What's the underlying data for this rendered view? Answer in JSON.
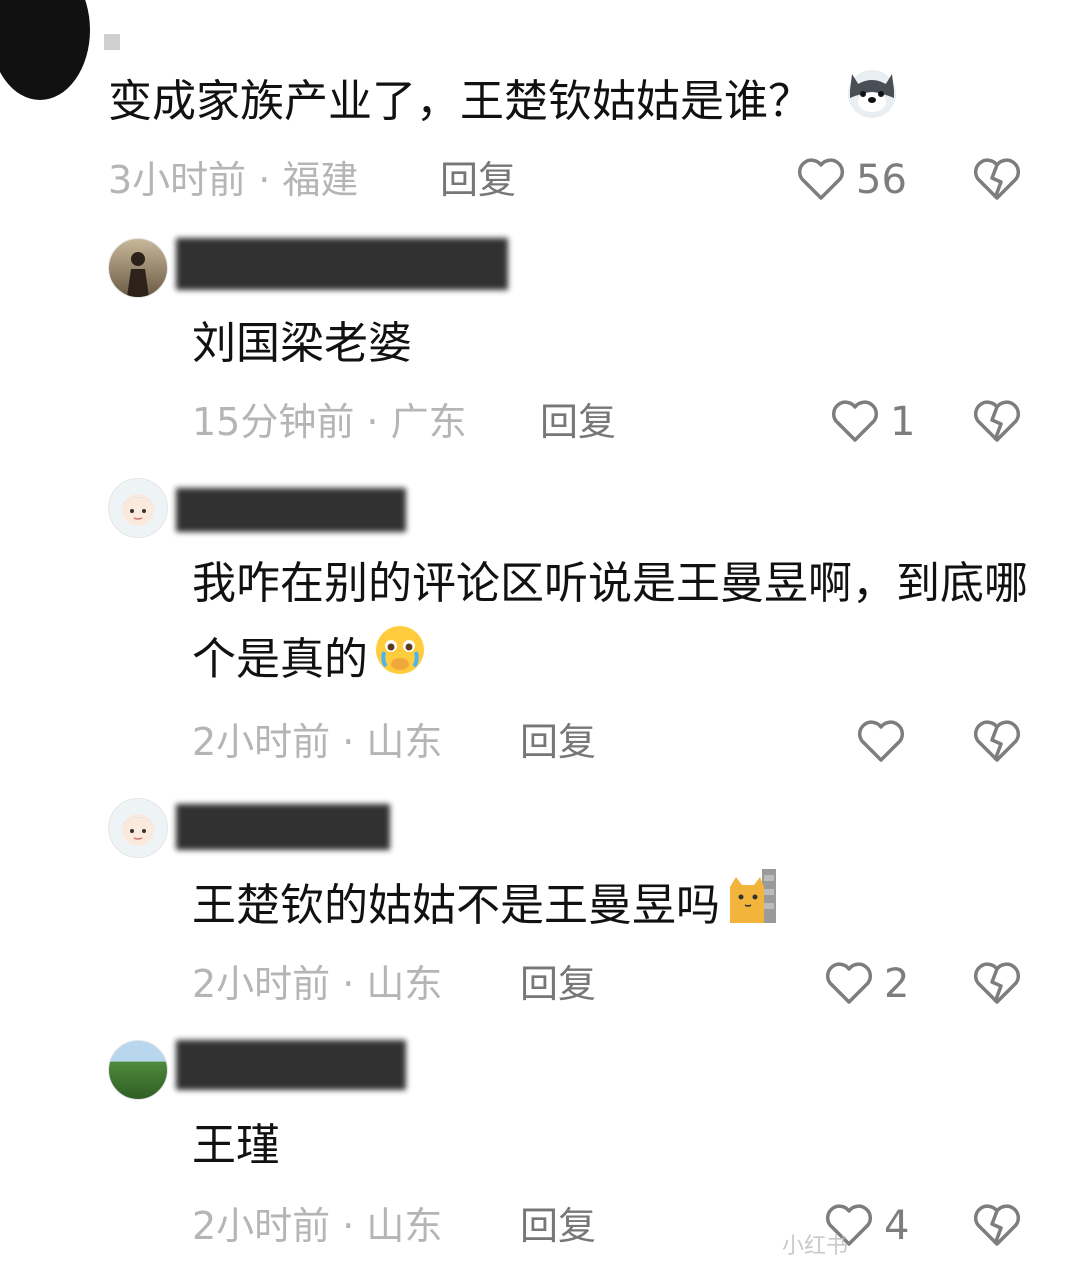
{
  "comments": [
    {
      "text": "变成家族产业了，王楚钦姑姑是谁？",
      "meta": "3小时前 · 福建",
      "reply": "回复",
      "likes": "56",
      "emoji": "wolf-emoji-icon"
    },
    {
      "text": "刘国梁老婆",
      "meta": "15分钟前 · 广东",
      "reply": "回复",
      "likes": "1"
    },
    {
      "text": "我咋在别的评论区听说是王曼昱啊，到底哪个是真的",
      "meta": "2小时前 · 山东",
      "reply": "回复",
      "likes": "",
      "emoji": "crying-face-emoji-icon"
    },
    {
      "text": "王楚钦的姑姑不是王曼昱吗",
      "meta": "2小时前 · 山东",
      "reply": "回复",
      "likes": "2",
      "emoji": "peeking-cat-emoji-icon"
    },
    {
      "text": "王瑾",
      "meta": "2小时前 · 山东",
      "reply": "回复",
      "likes": "4"
    }
  ],
  "watermark": "小红书",
  "icons": {
    "like": "heart-outline-icon",
    "dislike": "broken-heart-icon"
  },
  "colors": {
    "text": "#111111",
    "meta": "#b5b5b5",
    "reply": "#777777",
    "icon": "#7d7d7d"
  }
}
